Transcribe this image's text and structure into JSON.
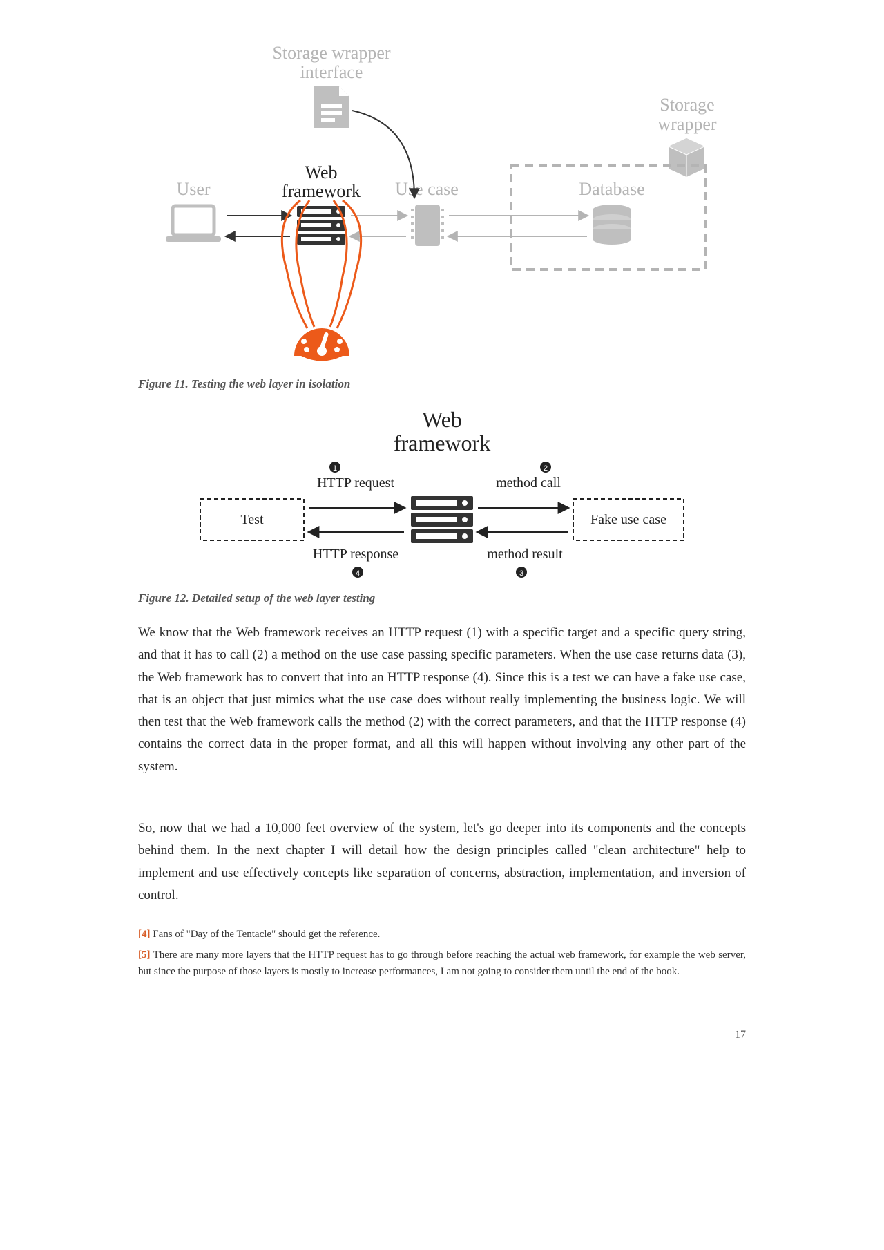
{
  "figure11": {
    "caption": "Figure 11. Testing the web layer in isolation",
    "labels": {
      "storage_wrapper_interface_l1": "Storage wrapper",
      "storage_wrapper_interface_l2": "interface",
      "storage_wrapper_l1": "Storage",
      "storage_wrapper_l2": "wrapper",
      "user": "User",
      "web_framework_l1": "Web",
      "web_framework_l2": "framework",
      "use_case": "Use case",
      "database": "Database"
    }
  },
  "figure12": {
    "caption": "Figure 12. Detailed setup of the web layer testing",
    "labels": {
      "web_framework_l1": "Web",
      "web_framework_l2": "framework",
      "test": "Test",
      "fake_use_case": "Fake use case",
      "http_request": "HTTP request",
      "http_response": "HTTP response",
      "method_call": "method call",
      "method_result": "method result",
      "n1": "1",
      "n2": "2",
      "n3": "3",
      "n4": "4"
    }
  },
  "paragraph1": "We know that the Web framework receives an HTTP request (1) with a specific target and a specific query string, and that it has to call (2) a method on the use case passing specific parameters. When the use case returns data (3), the Web framework has to convert that into an HTTP response (4). Since this is a test we can have a fake use case, that is an object that just mimics what the use case does without really implementing the business logic. We will then test that the Web framework calls the method (2) with the correct parameters, and that the HTTP response (4) contains the correct data in the proper format, and all this will happen without involving any other part of the system.",
  "paragraph2": "So, now that we had a 10,000 feet overview of the system, let's go deeper into its components and the concepts behind them. In the next chapter I will detail how the design principles called \"clean architecture\" help to implement and use effectively concepts like separation of concerns, abstraction, implementation, and inversion of control.",
  "footnotes": {
    "fn4_num": "4",
    "fn4_text": "Fans of \"Day of the Tentacle\" should get the reference.",
    "fn5_num": "5",
    "fn5_text": "There are many more layers that the HTTP request has to go through before reaching the actual web framework, for example the web server, but since the purpose of those layers is mostly to increase performances, I am not going to consider them until the end of the book."
  },
  "page_number": "17"
}
